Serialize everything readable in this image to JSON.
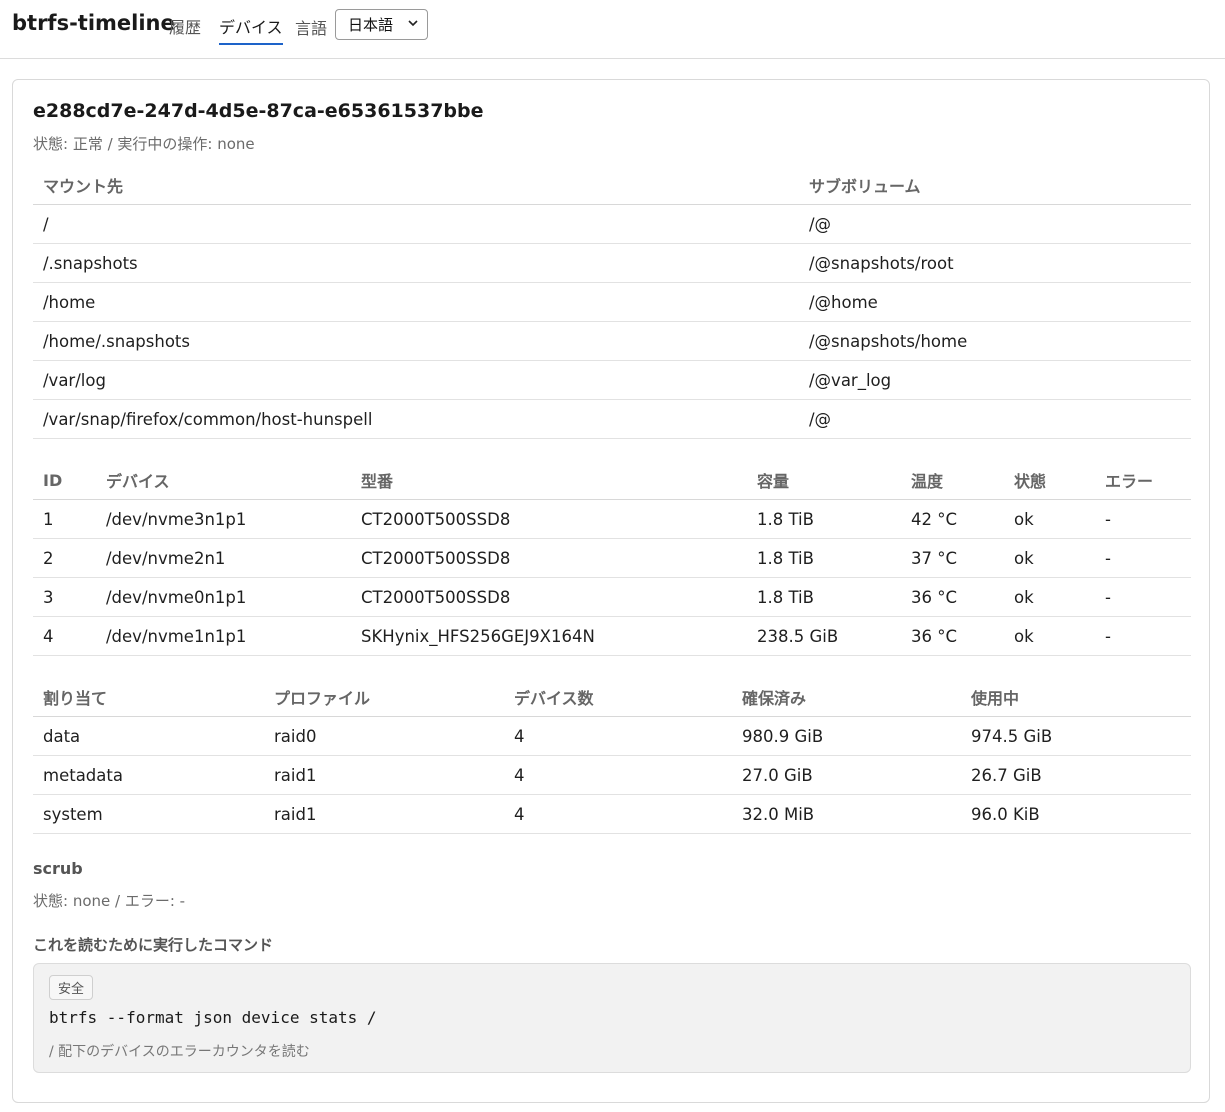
{
  "app": {
    "title": "btrfs-timeline",
    "nav": {
      "history": "履歴",
      "devices": "デバイス"
    },
    "language_label": "言語",
    "language_selected": "日本語"
  },
  "filesystem": {
    "uuid": "e288cd7e-247d-4d5e-87ca-e65361537bbe",
    "status_line": "状態: 正常 / 実行中の操作: none"
  },
  "mounts": {
    "headers": {
      "mount": "マウント先",
      "subvol": "サブボリューム"
    },
    "rows": [
      {
        "mount": "/",
        "subvol": "/@"
      },
      {
        "mount": "/.snapshots",
        "subvol": "/@snapshots/root"
      },
      {
        "mount": "/home",
        "subvol": "/@home"
      },
      {
        "mount": "/home/.snapshots",
        "subvol": "/@snapshots/home"
      },
      {
        "mount": "/var/log",
        "subvol": "/@var_log"
      },
      {
        "mount": "/var/snap/firefox/common/host-hunspell",
        "subvol": "/@"
      }
    ]
  },
  "devices": {
    "headers": {
      "id": "ID",
      "device": "デバイス",
      "model": "型番",
      "size": "容量",
      "temp": "温度",
      "state": "状態",
      "errors": "エラー"
    },
    "rows": [
      {
        "id": "1",
        "device": "/dev/nvme3n1p1",
        "model": "CT2000T500SSD8",
        "size": "1.8 TiB",
        "temp": "42 °C",
        "state": "ok",
        "errors": "-"
      },
      {
        "id": "2",
        "device": "/dev/nvme2n1",
        "model": "CT2000T500SSD8",
        "size": "1.8 TiB",
        "temp": "37 °C",
        "state": "ok",
        "errors": "-"
      },
      {
        "id": "3",
        "device": "/dev/nvme0n1p1",
        "model": "CT2000T500SSD8",
        "size": "1.8 TiB",
        "temp": "36 °C",
        "state": "ok",
        "errors": "-"
      },
      {
        "id": "4",
        "device": "/dev/nvme1n1p1",
        "model": "SKHynix_HFS256GEJ9X164N",
        "size": "238.5 GiB",
        "temp": "36 °C",
        "state": "ok",
        "errors": "-"
      }
    ]
  },
  "allocation": {
    "headers": {
      "type": "割り当て",
      "profile": "プロファイル",
      "count": "デバイス数",
      "reserved": "確保済み",
      "used": "使用中"
    },
    "rows": [
      {
        "type": "data",
        "profile": "raid0",
        "count": "4",
        "reserved": "980.9 GiB",
        "used": "974.5 GiB"
      },
      {
        "type": "metadata",
        "profile": "raid1",
        "count": "4",
        "reserved": "27.0 GiB",
        "used": "26.7 GiB"
      },
      {
        "type": "system",
        "profile": "raid1",
        "count": "4",
        "reserved": "32.0 MiB",
        "used": "96.0 KiB"
      }
    ]
  },
  "scrub": {
    "title": "scrub",
    "status_line": "状態: none / エラー: -"
  },
  "command": {
    "title": "これを読むために実行したコマンド",
    "badge": "安全",
    "text": "btrfs --format json device stats /",
    "description": "/ 配下のデバイスのエラーカウンタを読む"
  }
}
